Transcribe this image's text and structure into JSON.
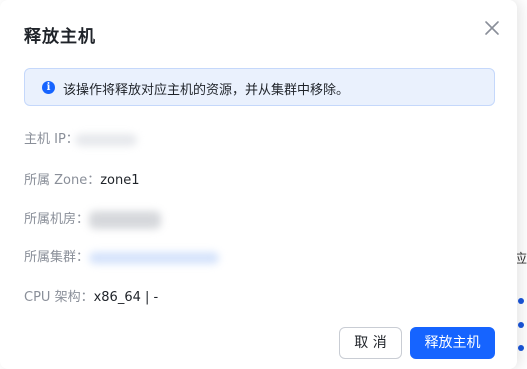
{
  "dialog": {
    "title": "释放主机",
    "alert_text": "该操作将释放对应主机的资源，并从集群中移除。",
    "fields": [
      {
        "label": "主机 IP：",
        "value": ""
      },
      {
        "label": "所属 Zone：",
        "value": "zone1"
      },
      {
        "label": "所属机房：",
        "value": ""
      },
      {
        "label": "所属集群：",
        "value": ""
      },
      {
        "label": "CPU 架构：",
        "value": "x86_64 | -"
      }
    ],
    "cancel_label": "取 消",
    "confirm_label": "释放主机"
  },
  "background": {
    "peek_char": "应"
  },
  "colors": {
    "primary": "#1664ff",
    "alert_bg": "#eaf1fd",
    "alert_border": "#c5d8fb",
    "label": "#8a8f99",
    "text": "#1f2329"
  },
  "icons": {
    "close": "close-icon",
    "info": "info-circle-icon"
  }
}
